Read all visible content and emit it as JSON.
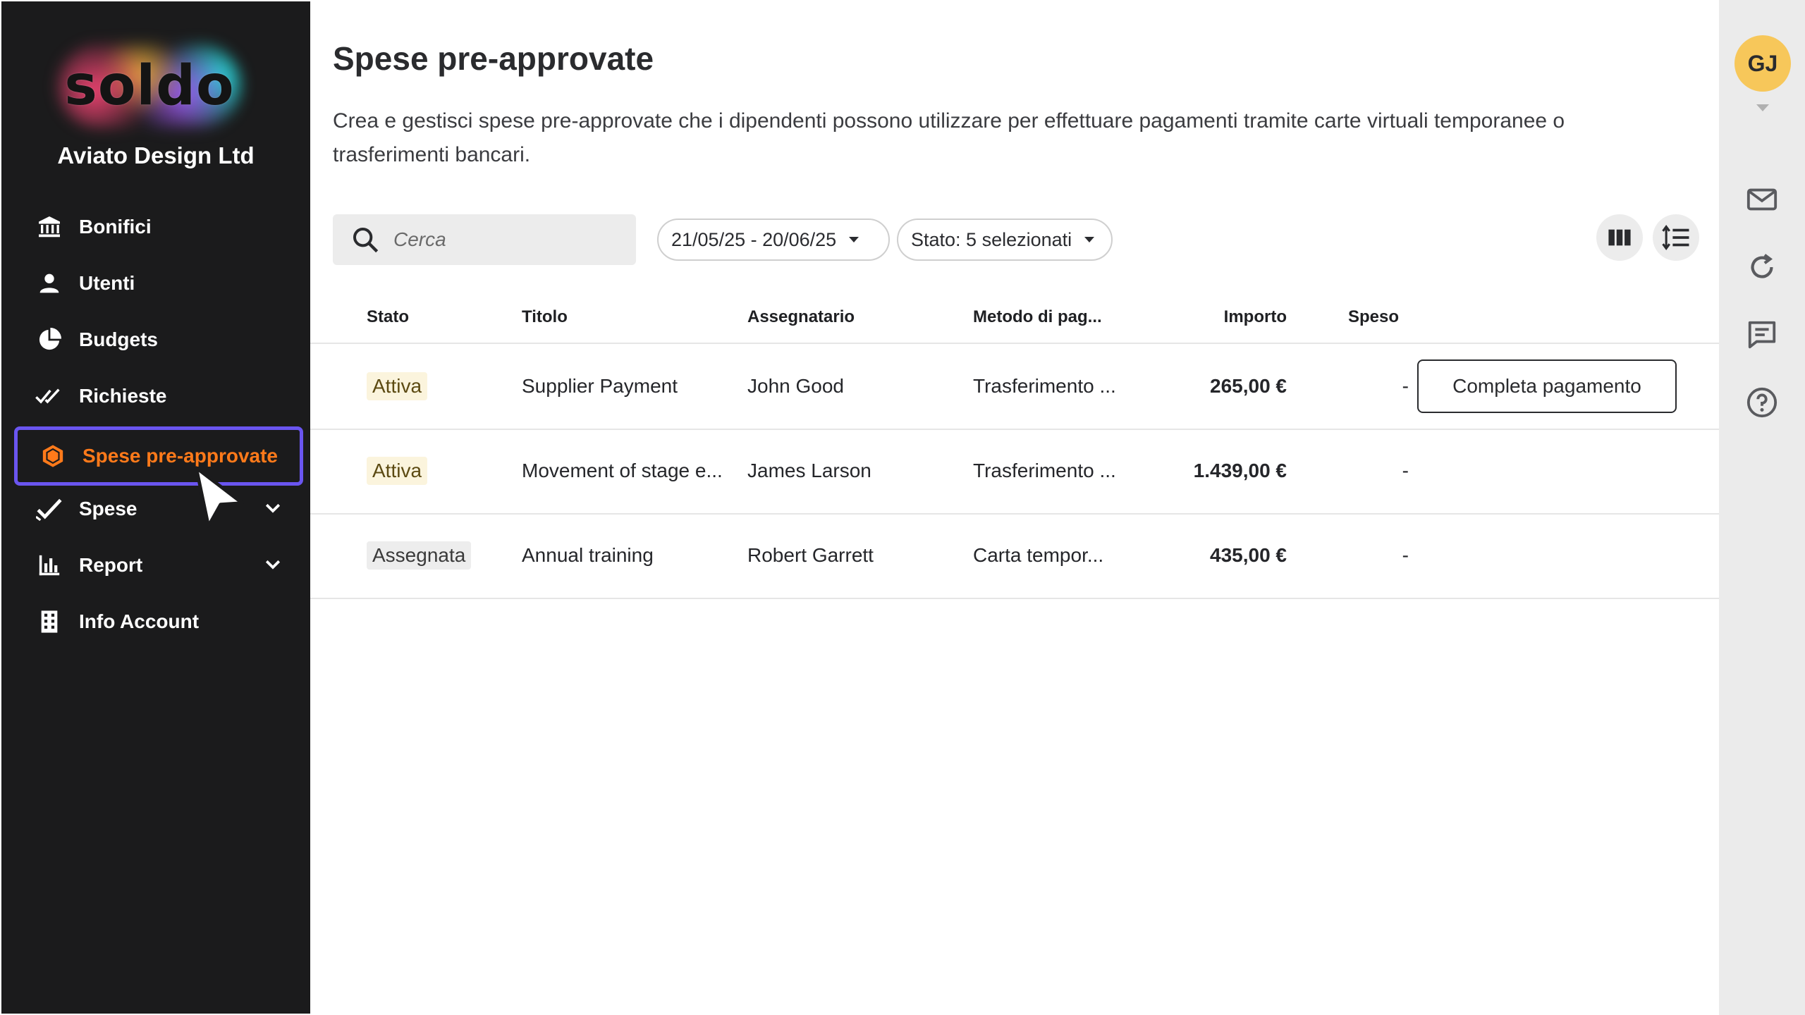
{
  "sidebar": {
    "logo_text": "soldo",
    "company": "Aviato Design Ltd",
    "items": [
      {
        "label": "Bonifici",
        "icon": "bank-transfer-icon"
      },
      {
        "label": "Utenti",
        "icon": "user-icon"
      },
      {
        "label": "Budgets",
        "icon": "pie-chart-icon"
      },
      {
        "label": "Richieste",
        "icon": "double-check-icon"
      },
      {
        "label": "Spese pre-approvate",
        "icon": "hexagon-icon"
      },
      {
        "label": "Spese",
        "icon": "check-icon"
      },
      {
        "label": "Report",
        "icon": "bar-chart-icon"
      },
      {
        "label": "Info Account",
        "icon": "building-icon"
      }
    ],
    "active_color": "#ff7a1a",
    "highlight_color": "#6a55f0"
  },
  "main": {
    "title": "Spese pre-approvate",
    "description": "Crea e gestisci spese pre-approvate che i dipendenti possono utilizzare per effettuare pagamenti tramite carte virtuali temporanee o trasferimenti bancari.",
    "search_placeholder": "Cerca",
    "date_filter": "21/05/25 - 20/06/25",
    "status_filter": "Stato: 5 selezionati",
    "table": {
      "headers": [
        "Stato",
        "Titolo",
        "Assegnatario",
        "Metodo di pag...",
        "Importo",
        "Speso"
      ],
      "rows": [
        {
          "stato": "Attiva",
          "titolo": "Supplier Payment",
          "assegnatario": "John Good",
          "metodo": "Trasferimento ...",
          "importo": "265,00 €",
          "speso": "-",
          "action": "Completa pagamento"
        },
        {
          "stato": "Attiva",
          "titolo": "Movement of stage e...",
          "assegnatario": "James Larson",
          "metodo": "Trasferimento ...",
          "importo": "1.439,00 €",
          "speso": "-"
        },
        {
          "stato": "Assegnata",
          "titolo": "Annual training",
          "assegnatario": "Robert Garrett",
          "metodo": "Carta tempor...",
          "importo": "435,00 €",
          "speso": "-"
        }
      ]
    }
  },
  "rail": {
    "avatar_initials": "GJ",
    "avatar_color": "#f7c75a",
    "icons": [
      "mail-icon",
      "refresh-icon",
      "chat-icon",
      "help-icon"
    ]
  }
}
